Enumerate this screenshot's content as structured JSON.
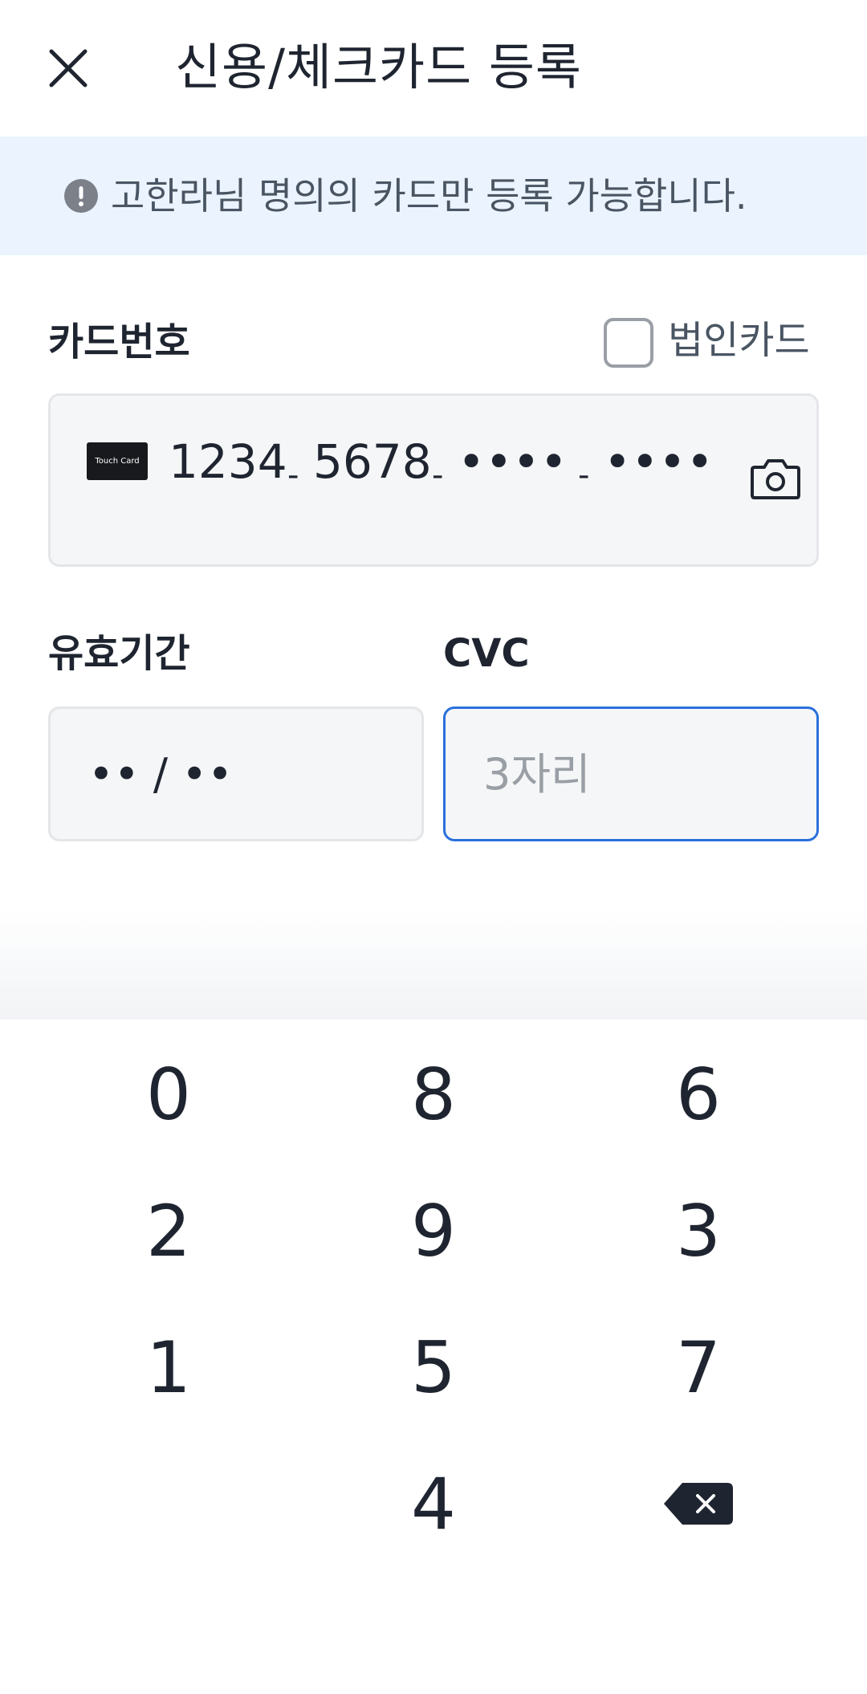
{
  "header": {
    "title": "신용/체크카드 등록",
    "close_icon": "close-icon"
  },
  "notice": {
    "icon": "exclamation-circle-icon",
    "text": "고한라님 명의의 카드만 등록 가능합니다."
  },
  "card_number": {
    "label": "카드번호",
    "corporate_checkbox_label": "법인카드",
    "corporate_checked": false,
    "brand_logo_text": "Touch Card",
    "segments": [
      "1234",
      "5678",
      "••••",
      "••••"
    ],
    "separator": "-",
    "camera_icon": "camera-icon"
  },
  "expiry": {
    "label": "유효기간",
    "value": "•• / ••"
  },
  "cvc": {
    "label": "CVC",
    "placeholder": "3자리",
    "value": ""
  },
  "keypad": {
    "rows": [
      [
        "0",
        "8",
        "6"
      ],
      [
        "2",
        "9",
        "3"
      ],
      [
        "1",
        "5",
        "7"
      ],
      [
        "",
        "4",
        "backspace"
      ]
    ],
    "backspace_icon": "backspace-icon"
  },
  "colors": {
    "accent": "#2a70dc",
    "notice_bg": "#ebf3fe",
    "field_bg": "#f5f6f7",
    "text": "#1f2530"
  }
}
